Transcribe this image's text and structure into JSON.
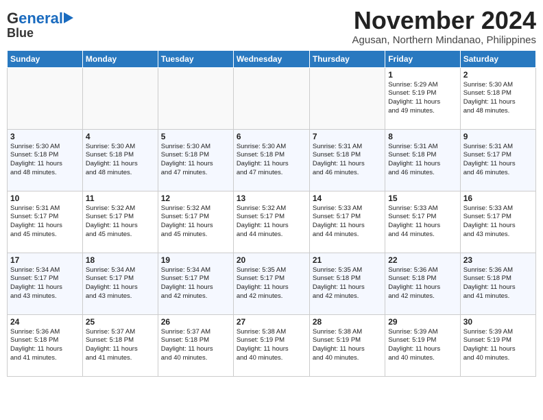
{
  "header": {
    "logo_line1": "General",
    "logo_line2": "Blue",
    "title": "November 2024",
    "subtitle": "Agusan, Northern Mindanao, Philippines"
  },
  "weekdays": [
    "Sunday",
    "Monday",
    "Tuesday",
    "Wednesday",
    "Thursday",
    "Friday",
    "Saturday"
  ],
  "weeks": [
    [
      {
        "day": "",
        "info": ""
      },
      {
        "day": "",
        "info": ""
      },
      {
        "day": "",
        "info": ""
      },
      {
        "day": "",
        "info": ""
      },
      {
        "day": "",
        "info": ""
      },
      {
        "day": "1",
        "info": "Sunrise: 5:29 AM\nSunset: 5:19 PM\nDaylight: 11 hours\nand 49 minutes."
      },
      {
        "day": "2",
        "info": "Sunrise: 5:30 AM\nSunset: 5:18 PM\nDaylight: 11 hours\nand 48 minutes."
      }
    ],
    [
      {
        "day": "3",
        "info": "Sunrise: 5:30 AM\nSunset: 5:18 PM\nDaylight: 11 hours\nand 48 minutes."
      },
      {
        "day": "4",
        "info": "Sunrise: 5:30 AM\nSunset: 5:18 PM\nDaylight: 11 hours\nand 48 minutes."
      },
      {
        "day": "5",
        "info": "Sunrise: 5:30 AM\nSunset: 5:18 PM\nDaylight: 11 hours\nand 47 minutes."
      },
      {
        "day": "6",
        "info": "Sunrise: 5:30 AM\nSunset: 5:18 PM\nDaylight: 11 hours\nand 47 minutes."
      },
      {
        "day": "7",
        "info": "Sunrise: 5:31 AM\nSunset: 5:18 PM\nDaylight: 11 hours\nand 46 minutes."
      },
      {
        "day": "8",
        "info": "Sunrise: 5:31 AM\nSunset: 5:18 PM\nDaylight: 11 hours\nand 46 minutes."
      },
      {
        "day": "9",
        "info": "Sunrise: 5:31 AM\nSunset: 5:17 PM\nDaylight: 11 hours\nand 46 minutes."
      }
    ],
    [
      {
        "day": "10",
        "info": "Sunrise: 5:31 AM\nSunset: 5:17 PM\nDaylight: 11 hours\nand 45 minutes."
      },
      {
        "day": "11",
        "info": "Sunrise: 5:32 AM\nSunset: 5:17 PM\nDaylight: 11 hours\nand 45 minutes."
      },
      {
        "day": "12",
        "info": "Sunrise: 5:32 AM\nSunset: 5:17 PM\nDaylight: 11 hours\nand 45 minutes."
      },
      {
        "day": "13",
        "info": "Sunrise: 5:32 AM\nSunset: 5:17 PM\nDaylight: 11 hours\nand 44 minutes."
      },
      {
        "day": "14",
        "info": "Sunrise: 5:33 AM\nSunset: 5:17 PM\nDaylight: 11 hours\nand 44 minutes."
      },
      {
        "day": "15",
        "info": "Sunrise: 5:33 AM\nSunset: 5:17 PM\nDaylight: 11 hours\nand 44 minutes."
      },
      {
        "day": "16",
        "info": "Sunrise: 5:33 AM\nSunset: 5:17 PM\nDaylight: 11 hours\nand 43 minutes."
      }
    ],
    [
      {
        "day": "17",
        "info": "Sunrise: 5:34 AM\nSunset: 5:17 PM\nDaylight: 11 hours\nand 43 minutes."
      },
      {
        "day": "18",
        "info": "Sunrise: 5:34 AM\nSunset: 5:17 PM\nDaylight: 11 hours\nand 43 minutes."
      },
      {
        "day": "19",
        "info": "Sunrise: 5:34 AM\nSunset: 5:17 PM\nDaylight: 11 hours\nand 42 minutes."
      },
      {
        "day": "20",
        "info": "Sunrise: 5:35 AM\nSunset: 5:17 PM\nDaylight: 11 hours\nand 42 minutes."
      },
      {
        "day": "21",
        "info": "Sunrise: 5:35 AM\nSunset: 5:18 PM\nDaylight: 11 hours\nand 42 minutes."
      },
      {
        "day": "22",
        "info": "Sunrise: 5:36 AM\nSunset: 5:18 PM\nDaylight: 11 hours\nand 42 minutes."
      },
      {
        "day": "23",
        "info": "Sunrise: 5:36 AM\nSunset: 5:18 PM\nDaylight: 11 hours\nand 41 minutes."
      }
    ],
    [
      {
        "day": "24",
        "info": "Sunrise: 5:36 AM\nSunset: 5:18 PM\nDaylight: 11 hours\nand 41 minutes."
      },
      {
        "day": "25",
        "info": "Sunrise: 5:37 AM\nSunset: 5:18 PM\nDaylight: 11 hours\nand 41 minutes."
      },
      {
        "day": "26",
        "info": "Sunrise: 5:37 AM\nSunset: 5:18 PM\nDaylight: 11 hours\nand 40 minutes."
      },
      {
        "day": "27",
        "info": "Sunrise: 5:38 AM\nSunset: 5:19 PM\nDaylight: 11 hours\nand 40 minutes."
      },
      {
        "day": "28",
        "info": "Sunrise: 5:38 AM\nSunset: 5:19 PM\nDaylight: 11 hours\nand 40 minutes."
      },
      {
        "day": "29",
        "info": "Sunrise: 5:39 AM\nSunset: 5:19 PM\nDaylight: 11 hours\nand 40 minutes."
      },
      {
        "day": "30",
        "info": "Sunrise: 5:39 AM\nSunset: 5:19 PM\nDaylight: 11 hours\nand 40 minutes."
      }
    ]
  ]
}
